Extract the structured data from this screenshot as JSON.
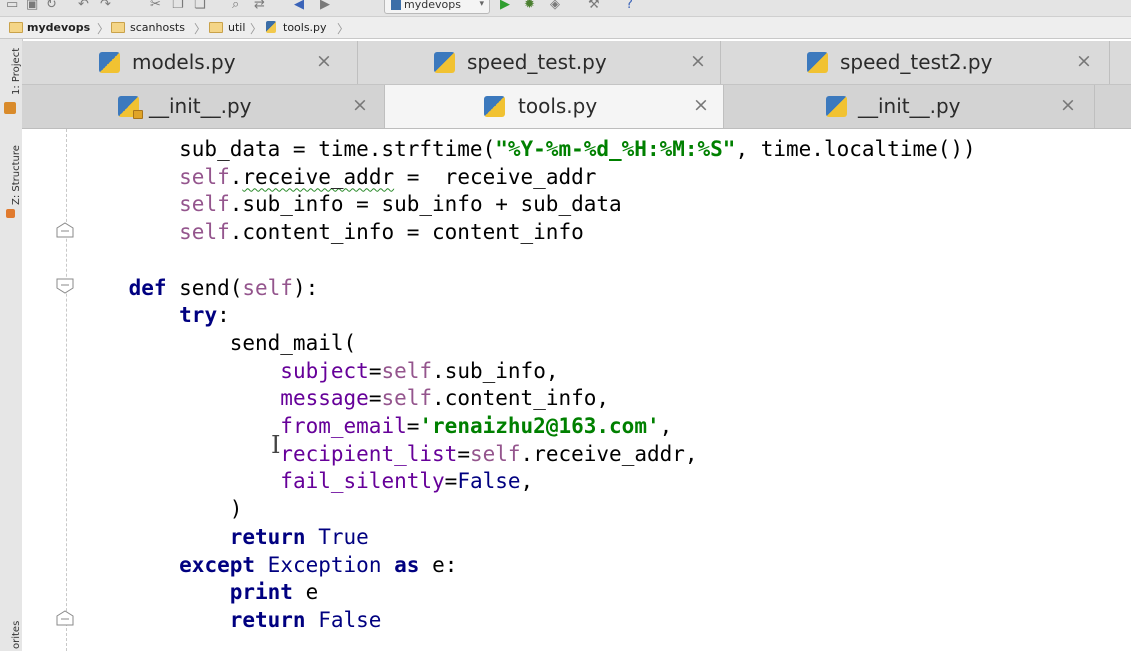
{
  "toolbar": {
    "run_config_label": "mydevops",
    "help_glyph": "?",
    "icons": [
      "open-icon",
      "save-icon",
      "sync-icon",
      "undo-icon",
      "redo-icon",
      "cut-icon",
      "copy-icon",
      "paste-icon",
      "find-icon",
      "replace-icon",
      "back-icon",
      "forward-icon",
      "run-config-dropdown-icon",
      "run-icon",
      "debug-icon",
      "coverage-icon",
      "settings-icon",
      "help-icon"
    ]
  },
  "breadcrumb": [
    "mydevops",
    "scanhosts",
    "util",
    "tools.py"
  ],
  "side_panel": {
    "project_label": "1: Project",
    "structure_label": "Z: Structure",
    "favorites_label": "orites"
  },
  "tabs": {
    "row1": [
      {
        "label": "models.py",
        "close": "×"
      },
      {
        "label": "speed_test.py",
        "close": "×"
      },
      {
        "label": "speed_test2.py",
        "close": "×"
      }
    ],
    "row2": [
      {
        "label": "__init__.py",
        "close": "×",
        "locked": true
      },
      {
        "label": "tools.py",
        "close": "×",
        "active": true
      },
      {
        "label": "__init__.py",
        "close": "×"
      }
    ]
  },
  "code_lines": [
    "        sub_data = time.strftime(\"%Y-%m-%d_%H:%M:%S\", time.localtime())",
    "        self.receive_addr =  receive_addr",
    "        self.sub_info = sub_info + sub_data",
    "        self.content_info = content_info",
    "",
    "    def send(self):",
    "        try:",
    "            send_mail(",
    "                subject=self.sub_info,",
    "                message=self.content_info,",
    "                from_email='renaizhu2@163.com',",
    "                recipient_list=self.receive_addr,",
    "                fail_silently=False,",
    "            )",
    "            return True",
    "        except Exception as e:",
    "            print e",
    "            return False"
  ],
  "colors": {
    "keyword": "#000080",
    "self": "#94558d",
    "param": "#660099",
    "string": "#008000",
    "tab_active": "#f5f5f5",
    "tab_inactive": "#dadada"
  }
}
